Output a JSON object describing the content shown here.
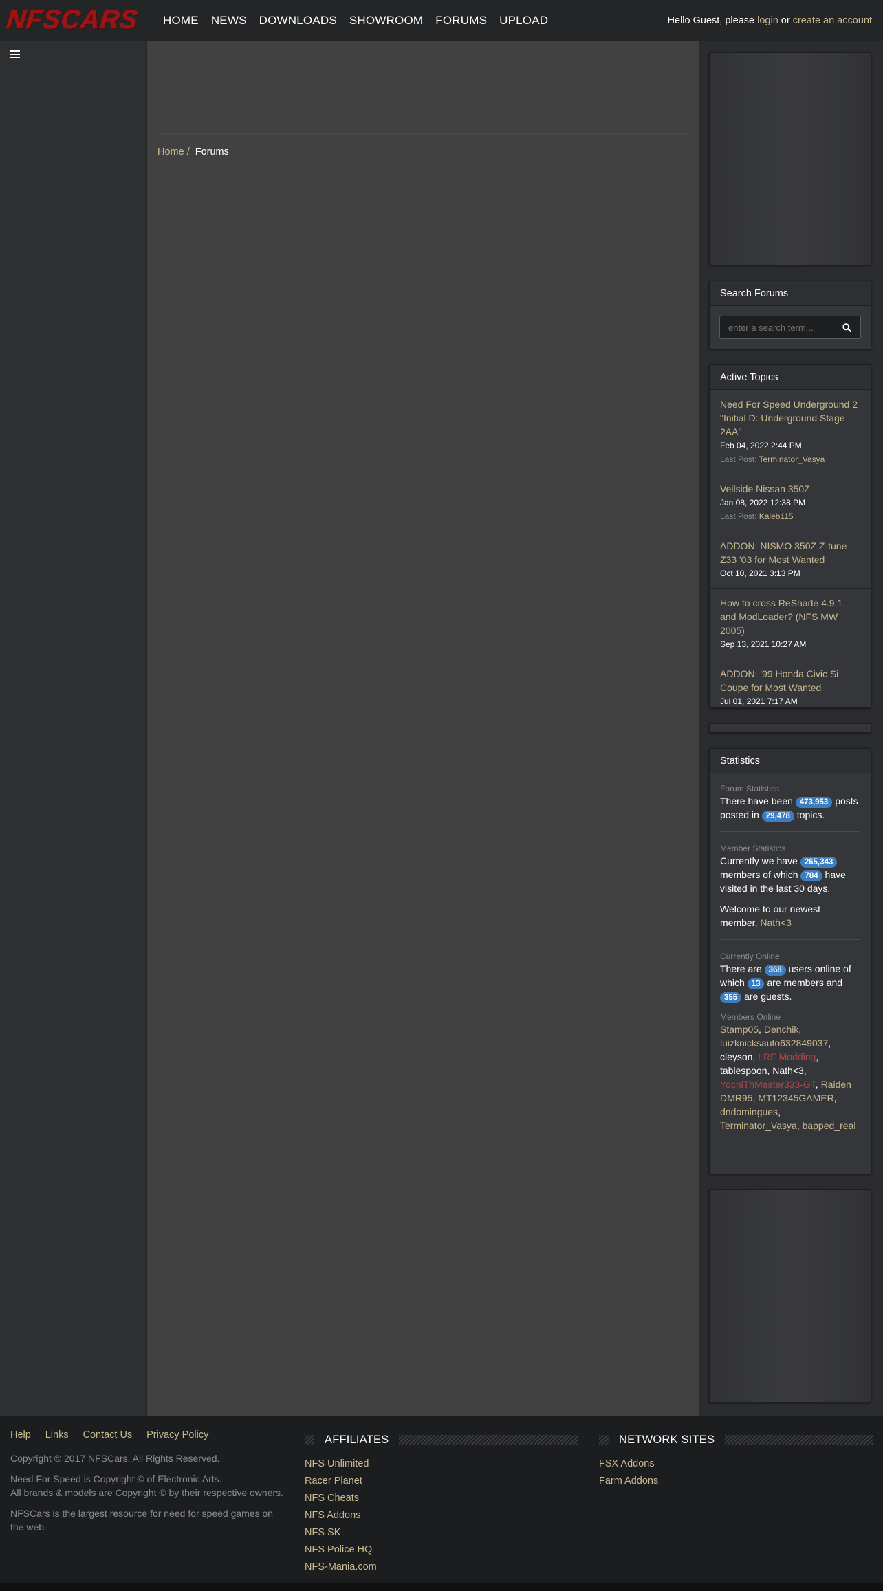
{
  "header": {
    "logo_text": "NFSCARS",
    "nav": [
      "HOME",
      "NEWS",
      "DOWNLOADS",
      "SHOWROOM",
      "FORUMS",
      "UPLOAD"
    ],
    "guest_prefix": "Hello Guest, please ",
    "login": "login",
    "or": " or ",
    "create_account": "create an account"
  },
  "breadcrumb": {
    "home": "Home",
    "separator": "/",
    "current": "Forums"
  },
  "search": {
    "title": "Search Forums",
    "placeholder": "enter a search term..."
  },
  "active_topics": {
    "title": "Active Topics",
    "last_post_label": "Last Post:",
    "items": [
      {
        "title": "Need For Speed Underground 2 \"Initial D: Underground Stage 2AA\"",
        "date": "Feb 04, 2022 2:44 PM",
        "last_post": "Terminator_Vasya"
      },
      {
        "title": "Veilside Nissan 350Z",
        "date": "Jan 08, 2022 12:38 PM",
        "last_post": "Kaleb115"
      },
      {
        "title": "ADDON: NISMO 350Z Z-tune Z33 '03 for Most Wanted",
        "date": "Oct 10, 2021 3:13 PM",
        "last_post": ""
      },
      {
        "title": "How to cross ReShade 4.9.1. and ModLoader? (NFS MW 2005)",
        "date": "Sep 13, 2021 10:27 AM",
        "last_post": ""
      },
      {
        "title": "ADDON: '99 Honda Civic Si Coupe for Most Wanted",
        "date": "Jul 01, 2021 7:17 AM",
        "last_post": ""
      }
    ]
  },
  "statistics": {
    "title": "Statistics",
    "forum_label": "Forum Statistics",
    "posts_pre": "There have been ",
    "posts": "473,953",
    "posts_mid": " posts posted in ",
    "topics": "29,478",
    "posts_post": " topics.",
    "member_label": "Member Statistics",
    "members_pre": "Currently we have ",
    "members": "265,343",
    "members_mid": " members of which ",
    "active": "784",
    "members_post": " have visited in the last 30 days.",
    "newest_pre": "Welcome to our newest member, ",
    "newest": "Nath<3",
    "online_label": "Currently Online",
    "online_pre": "There are ",
    "online": "368",
    "online_mid": " users online of which ",
    "online_members": "13",
    "online_mid2": " are members and ",
    "online_guests": "355",
    "online_post": " are guests.",
    "members_online_label": "Members Online",
    "members_online": [
      {
        "name": "Stamp05",
        "color": "gold"
      },
      {
        "name": "Denchik",
        "color": "gold"
      },
      {
        "name": "luizknicksauto632849037",
        "color": "gold"
      },
      {
        "name": "cleyson",
        "color": "white"
      },
      {
        "name": "LRF Modding",
        "color": "red"
      },
      {
        "name": "tablespoon",
        "color": "white"
      },
      {
        "name": "Nath<3",
        "color": "white"
      },
      {
        "name": "YochiThMaster333-GT",
        "color": "red"
      },
      {
        "name": "Raiden DMR95",
        "color": "gold"
      },
      {
        "name": "MT12345GAMER",
        "color": "gold"
      },
      {
        "name": "dndomingues",
        "color": "gold"
      },
      {
        "name": "Terminator_Vasya",
        "color": "gold"
      },
      {
        "name": "bapped_real",
        "color": "gold"
      }
    ]
  },
  "footer": {
    "links": [
      "Help",
      "Links",
      "Contact Us",
      "Privacy Policy"
    ],
    "copyright": "Copyright © 2017 NFSCars, All Rights Reserved.",
    "ea_notice": "Need For Speed is Copyright © of Electronic Arts.",
    "brands_notice": "All brands & models are Copyright © by their respective owners.",
    "about": "NFSCars is the largest resource for need for speed games on the web.",
    "affiliates_title": "AFFILIATES",
    "affiliates": [
      "NFS Unlimited",
      "Racer Planet",
      "NFS Cheats",
      "NFS Addons",
      "NFS SK",
      "NFS Police HQ",
      "NFS-Mania.com"
    ],
    "network_title": "NETWORK SITES",
    "network": [
      "FSX Addons",
      "Farm Addons"
    ]
  },
  "colors": {
    "accent_link": "#c8b98f",
    "badge": "#3d7ec1",
    "logo_red": "#9a1414",
    "staff_red": "#b04545"
  }
}
